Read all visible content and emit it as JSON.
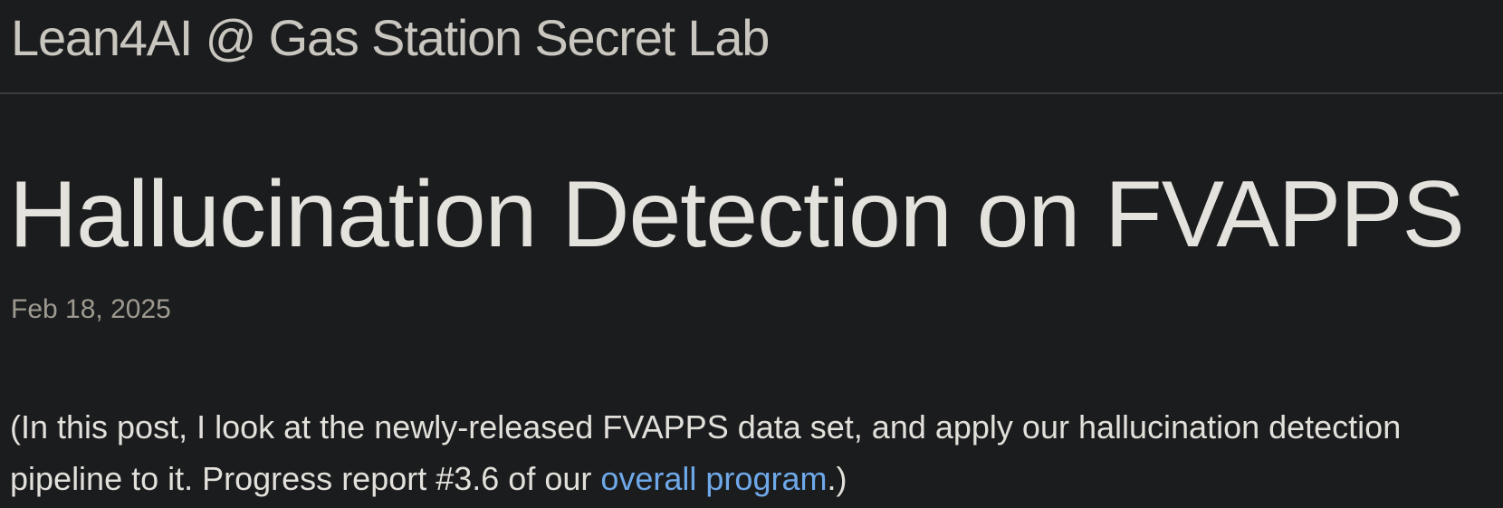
{
  "header": {
    "site_title": "Lean4AI @ Gas Station Secret Lab"
  },
  "post": {
    "title": "Hallucination Detection on FVAPPS",
    "date": "Feb 18, 2025",
    "intro": {
      "before_link": "(In this post, I look at the newly-released FVAPPS data set, and apply our hallucination detection pipeline to it. Progress report #3.6 of our ",
      "link_text": "overall program",
      "after_link": ".)"
    }
  },
  "colors": {
    "background": "#1b1c1e",
    "text": "#e2e0da",
    "muted": "#9e9a90",
    "link": "#6ea8e8",
    "divider": "#3a3b3d"
  }
}
